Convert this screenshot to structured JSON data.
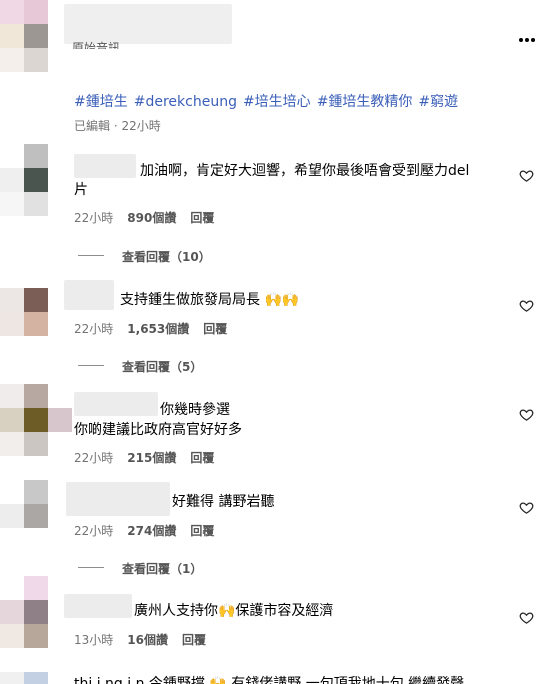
{
  "post": {
    "header_text": "原始音訊",
    "menu_icon": "more-dots-icon",
    "hashtags": [
      "#鍾培生",
      "#derekcheung",
      "#培生培心",
      "#鍾培生教精你",
      "#窮遊"
    ],
    "edited_time": "已編輯 · 22小時"
  },
  "comments": [
    {
      "text_line1": "加油啊，肯定好大迴響，希望你最後唔會受到壓力del",
      "text_line2": "片",
      "time": "22小時",
      "likes": "890個讚",
      "reply": "回覆",
      "view_replies": "查看回覆（10）"
    },
    {
      "text_line1": "支持鍾生做旅發局局長 🙌🙌",
      "time": "22小時",
      "likes": "1,653個讚",
      "reply": "回覆",
      "view_replies": "查看回覆（5）"
    },
    {
      "text_line1": "你幾時參選",
      "text_line2": "你啲建議比政府高官好好多",
      "time": "22小時",
      "likes": "215個讚",
      "reply": "回覆"
    },
    {
      "text_line1": "好難得 講野岩聽",
      "time": "22小時",
      "likes": "274個讚",
      "reply": "回覆",
      "view_replies": "查看回覆（1）"
    },
    {
      "text_line1": "廣州人支持你🙌保護市容及經濟",
      "time": "13小時",
      "likes": "16個讚",
      "reply": "回覆"
    }
  ],
  "partial_bottom_text": "thi.i.ng.i.n 今鍾野撐 🙌 有錢佬講野 一句頂我地十句 繼續發聲",
  "colors": {
    "hashtag": "#3b5fb8",
    "meta": "#737373"
  }
}
